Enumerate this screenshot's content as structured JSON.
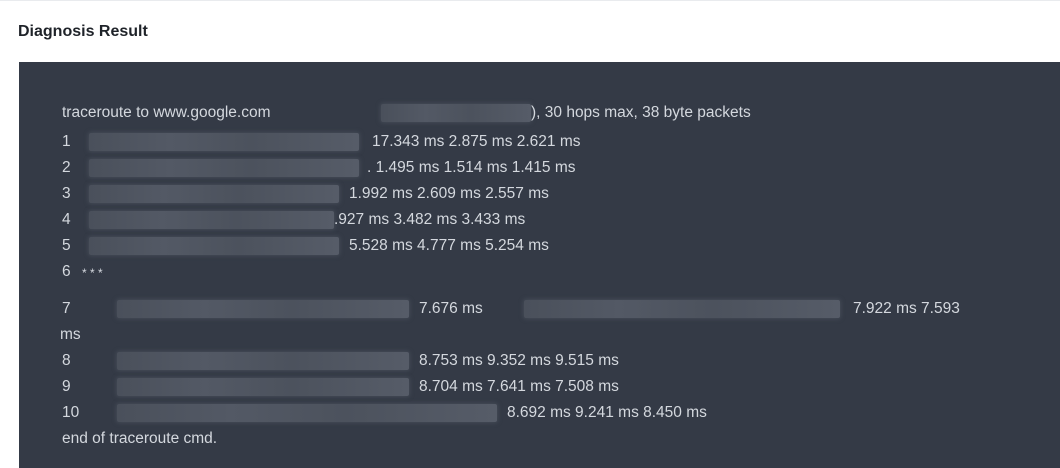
{
  "title": "Diagnosis Result",
  "output": {
    "header_prefix": "traceroute to www.google.com",
    "header_suffix": "), 30 hops max, 38 byte packets",
    "hops": [
      {
        "num": "1",
        "times": "17.343 ms  2.875 ms  2.621 ms"
      },
      {
        "num": "2",
        "times": ". 1.495 ms  1.514 ms  1.415 ms"
      },
      {
        "num": "3",
        "times": "1.992 ms  2.609 ms  2.557 ms"
      },
      {
        "num": "4",
        "times": ".927 ms  3.482 ms  3.433 ms"
      },
      {
        "num": "5",
        "times": "5.528 ms  4.777 ms  5.254 ms"
      },
      {
        "num": "6",
        "times": "* * *"
      },
      {
        "num": "7",
        "times_a": "7.676 ms",
        "times_b": "7.922 ms  7.593",
        "wrap": "ms"
      },
      {
        "num": "8",
        "times": "8.753 ms  9.352 ms  9.515 ms"
      },
      {
        "num": "9",
        "times": "8.704 ms  7.641 ms  7.508 ms"
      },
      {
        "num": "10",
        "times": "8.692 ms  9.241 ms  8.450 ms"
      }
    ],
    "footer": "end of traceroute cmd."
  }
}
